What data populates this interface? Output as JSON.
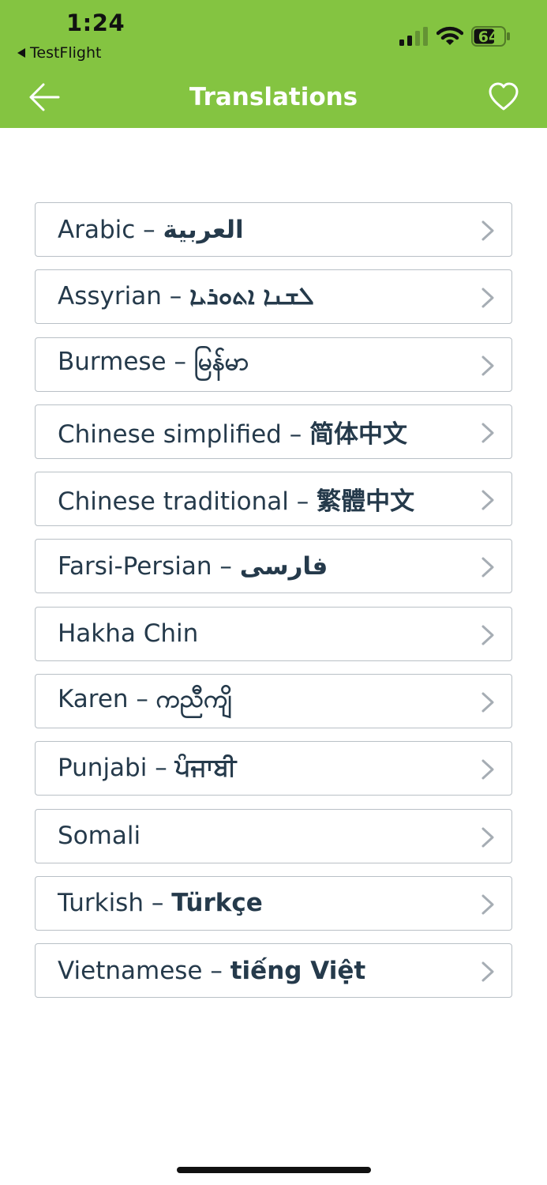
{
  "status_bar": {
    "time": "1:24",
    "back_app": "TestFlight",
    "battery": "64"
  },
  "nav": {
    "title": "Translations"
  },
  "colors": {
    "header": "#84c441",
    "text": "#253a4b",
    "border": "#b9c0c6"
  },
  "items": [
    {
      "name": "Arabic",
      "native": "العربية"
    },
    {
      "name": "Assyrian",
      "native": "ܠܫܢܐ ܐܬܘܪܝܐ"
    },
    {
      "name": "Burmese",
      "native": "မြန်မာ"
    },
    {
      "name": "Chinese simplified",
      "native": "简体中文"
    },
    {
      "name": "Chinese traditional",
      "native": "繁體中文"
    },
    {
      "name": "Farsi-Persian",
      "native": "فارسی"
    },
    {
      "name": "Hakha Chin",
      "native": ""
    },
    {
      "name": "Karen",
      "native": "ကညီကျိ"
    },
    {
      "name": "Punjabi",
      "native": "ਪੰਜਾਬੀ"
    },
    {
      "name": "Somali",
      "native": ""
    },
    {
      "name": "Turkish",
      "native": "Türkçe"
    },
    {
      "name": "Vietnamese",
      "native": "tiếng Việt"
    }
  ],
  "icons": {
    "back": "arrow-left-icon",
    "favorite": "heart-icon",
    "chevron": "chevron-right-icon"
  }
}
